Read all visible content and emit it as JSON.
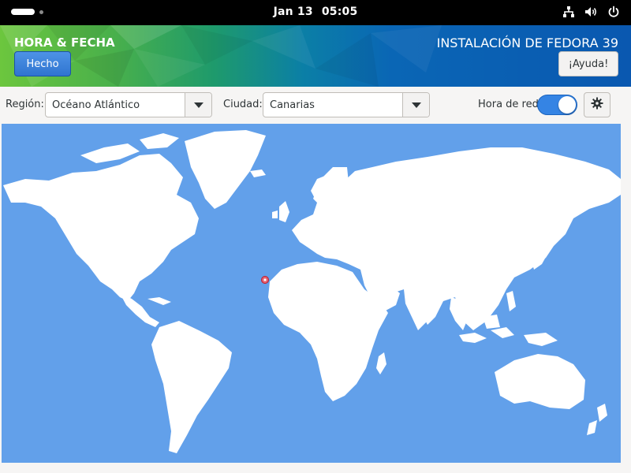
{
  "topbar": {
    "date": "Jan 13",
    "time": "05:05",
    "tray_icons": [
      "network-icon",
      "volume-icon",
      "power-icon"
    ]
  },
  "header": {
    "spoke_title": "HORA & FECHA",
    "done_label": "Hecho",
    "product_title": "INSTALACIÓN DE FEDORA 39",
    "help_label": "¡Ayuda!"
  },
  "toolbar": {
    "region_label": "Región:",
    "region_value": "Océano Atlántico",
    "city_label": "Ciudad:",
    "city_value": "Canarias",
    "network_time_label": "Hora de red",
    "network_time_enabled": true
  },
  "map": {
    "ocean_color": "#62a0ea",
    "land_color": "#ffffff",
    "marker_color": "#e66171"
  },
  "colors": {
    "accent": "#3584e4",
    "topbar": "#000000"
  }
}
